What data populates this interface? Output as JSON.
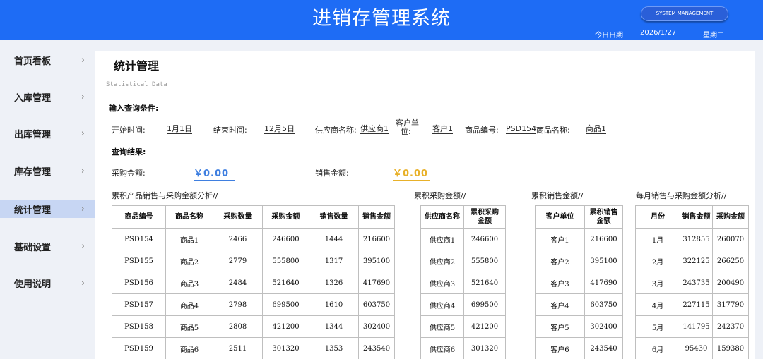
{
  "header": {
    "title": "进销存管理系统",
    "system_button": "SYSTEM MANAGEMENT",
    "date_label": "今日日期",
    "date_value": "2026/1/27",
    "weekday": "星期二"
  },
  "sidebar": {
    "items": [
      {
        "label": "首页看板"
      },
      {
        "label": "入库管理"
      },
      {
        "label": "出库管理"
      },
      {
        "label": "库存管理"
      },
      {
        "label": "统计管理"
      },
      {
        "label": "基础设置"
      },
      {
        "label": "使用说明"
      }
    ],
    "active": "统计管理"
  },
  "page": {
    "title": "统计管理",
    "subtitle": "Statistical Data",
    "query_header": "输入查询条件:",
    "result_header": "查询结果:"
  },
  "filters": {
    "start_label": "开始时间:",
    "start_value": "1月1日",
    "end_label": "结束时间:",
    "end_value": "12月5日",
    "supplier_label": "供应商名称:",
    "supplier_value": "供应商1",
    "customer_label_1": "客户单",
    "customer_label_2": "位:",
    "customer_value": "客户1",
    "product_code_label": "商品编号:",
    "product_code_value": "PSD154",
    "product_name_label": "商品名称:",
    "product_name_value": "商品1"
  },
  "results": {
    "purchase_label": "采购金额:",
    "purchase_value": "￥0.00",
    "sales_label": "销售金额:",
    "sales_value": "￥0.00",
    "purchase_color": "#3f7fe0",
    "sales_color": "#e8b12a"
  },
  "tables": {
    "products": {
      "title": "累积产品销售与采购金额分析//",
      "headers": [
        "商品编号",
        "商品名称",
        "采购数量",
        "采购金额",
        "销售数量",
        "销售金额"
      ],
      "rows": [
        [
          "PSD154",
          "商品1",
          "2466",
          "246600",
          "1444",
          "216600"
        ],
        [
          "PSD155",
          "商品2",
          "2779",
          "555800",
          "1317",
          "395100"
        ],
        [
          "PSD156",
          "商品3",
          "2484",
          "521640",
          "1326",
          "417690"
        ],
        [
          "PSD157",
          "商品4",
          "2798",
          "699500",
          "1610",
          "603750"
        ],
        [
          "PSD158",
          "商品5",
          "2808",
          "421200",
          "1344",
          "302400"
        ],
        [
          "PSD159",
          "商品6",
          "2511",
          "301320",
          "1353",
          "243540"
        ]
      ]
    },
    "purchase": {
      "title": "累积采购金额//",
      "headers": [
        "供应商名称",
        "累积采购金额"
      ],
      "rows": [
        [
          "供应商1",
          "246600"
        ],
        [
          "供应商2",
          "555800"
        ],
        [
          "供应商3",
          "521640"
        ],
        [
          "供应商4",
          "699500"
        ],
        [
          "供应商5",
          "421200"
        ],
        [
          "供应商6",
          "301320"
        ]
      ]
    },
    "sales": {
      "title": "累积销售金额//",
      "headers": [
        "客户单位",
        "累积销售金额"
      ],
      "rows": [
        [
          "客户1",
          "216600"
        ],
        [
          "客户2",
          "395100"
        ],
        [
          "客户3",
          "417690"
        ],
        [
          "客户4",
          "603750"
        ],
        [
          "客户5",
          "302400"
        ],
        [
          "客户6",
          "243540"
        ]
      ]
    },
    "monthly": {
      "title": "每月销售与采购金额分析//",
      "headers": [
        "月份",
        "销售金额",
        "采购金额"
      ],
      "rows": [
        [
          "1月",
          "312855",
          "260070"
        ],
        [
          "2月",
          "322125",
          "266250"
        ],
        [
          "3月",
          "243735",
          "200490"
        ],
        [
          "4月",
          "227115",
          "317790"
        ],
        [
          "5月",
          "141795",
          "242370"
        ],
        [
          "6月",
          "95430",
          "159380"
        ]
      ]
    }
  }
}
